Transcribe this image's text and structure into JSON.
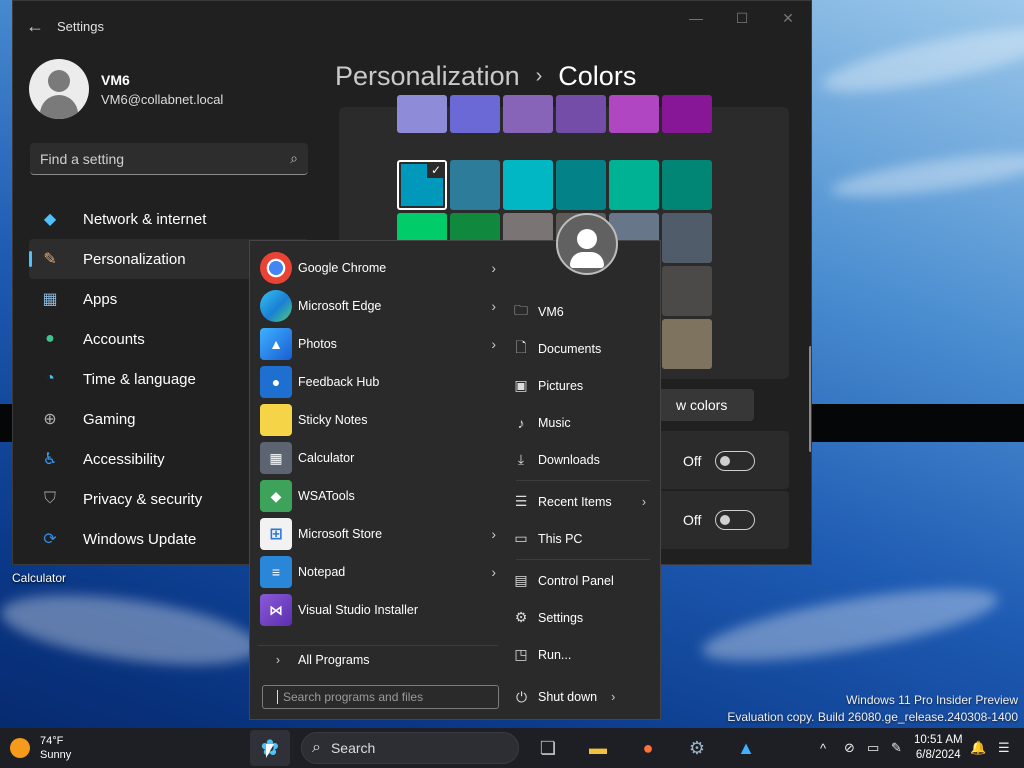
{
  "settings": {
    "window_title": "Settings",
    "user": {
      "name": "VM6",
      "email": "VM6@collabnet.local"
    },
    "search_placeholder": "Find a setting",
    "nav": [
      {
        "label": "Network & internet",
        "icon": "wifi-icon",
        "color": "#4cc2ff"
      },
      {
        "label": "Personalization",
        "icon": "brush-icon",
        "color": "#e8a86a",
        "selected": true
      },
      {
        "label": "Apps",
        "icon": "apps-icon",
        "color": "#8ab4d8"
      },
      {
        "label": "Accounts",
        "icon": "person-icon",
        "color": "#3fc48f"
      },
      {
        "label": "Time & language",
        "icon": "globe-clock-icon",
        "color": "#4cc2ff"
      },
      {
        "label": "Gaming",
        "icon": "gamepad-icon",
        "color": "#b0b0b0"
      },
      {
        "label": "Accessibility",
        "icon": "accessibility-icon",
        "color": "#3aa0ff"
      },
      {
        "label": "Privacy & security",
        "icon": "shield-icon",
        "color": "#9aa3ad"
      },
      {
        "label": "Windows Update",
        "icon": "update-icon",
        "color": "#2f8ee6"
      }
    ],
    "breadcrumb": {
      "parent": "Personalization",
      "separator": "›",
      "current": "Colors"
    },
    "swatches": [
      [
        "#8e8cd8",
        "#6b69d6",
        "#8764b8",
        "#744da9",
        "#b146c2",
        "#881798"
      ],
      [
        "#0099bc",
        "#2d7d9a",
        "#00b7c3",
        "#038387",
        "#00b294",
        "#018574"
      ],
      [
        "#00cc6a",
        "#10893e",
        "#7a7574",
        "#5d5a58",
        "#68768a",
        "#515c6b"
      ],
      [
        "",
        "",
        "",
        "",
        "#567c73",
        "#4c4a48"
      ],
      [
        "",
        "",
        "",
        "",
        "",
        "#7e735f"
      ]
    ],
    "selected_swatch": "#0099bc",
    "view_colors_label": "w colors",
    "toggles": [
      {
        "label": "Off"
      },
      {
        "label": "Off"
      }
    ]
  },
  "start_menu": {
    "programs": [
      {
        "label": "Google Chrome",
        "icon": "chrome-icon",
        "has_submenu": true
      },
      {
        "label": "Microsoft Edge",
        "icon": "edge-icon",
        "has_submenu": true
      },
      {
        "label": "Photos",
        "icon": "photos-icon",
        "has_submenu": true
      },
      {
        "label": "Feedback Hub",
        "icon": "feedback-hub-icon",
        "has_submenu": false
      },
      {
        "label": "Sticky Notes",
        "icon": "sticky-notes-icon",
        "has_submenu": false
      },
      {
        "label": "Calculator",
        "icon": "calculator-icon",
        "has_submenu": false
      },
      {
        "label": "WSATools",
        "icon": "wsatools-icon",
        "has_submenu": false
      },
      {
        "label": "Microsoft Store",
        "icon": "store-icon",
        "has_submenu": true
      },
      {
        "label": "Notepad",
        "icon": "notepad-icon",
        "has_submenu": true
      },
      {
        "label": "Visual Studio Installer",
        "icon": "vs-installer-icon",
        "has_submenu": false
      }
    ],
    "all_programs": "All Programs",
    "search_placeholder": "Search programs and files",
    "places": [
      {
        "label": "VM6",
        "icon": "user-folder-icon"
      },
      {
        "label": "Documents",
        "icon": "document-icon"
      },
      {
        "label": "Pictures",
        "icon": "pictures-icon"
      },
      {
        "label": "Music",
        "icon": "music-icon"
      },
      {
        "label": "Downloads",
        "icon": "download-icon"
      },
      {
        "label": "Recent Items",
        "icon": "recent-icon",
        "has_submenu": true
      },
      {
        "label": "This PC",
        "icon": "computer-icon"
      },
      {
        "label": "Control Panel",
        "icon": "control-panel-icon"
      },
      {
        "label": "Settings",
        "icon": "gear-icon"
      },
      {
        "label": "Run...",
        "icon": "run-icon"
      }
    ],
    "shutdown": "Shut down"
  },
  "desktop": {
    "icon_label": "Calculator",
    "watermark_line1": "Windows 11 Pro Insider Preview",
    "watermark_line2": "Evaluation copy. Build 26080.ge_release.240308-1400"
  },
  "taskbar": {
    "weather_temp": "74°F",
    "weather_desc": "Sunny",
    "search_label": "Search",
    "time": "10:51 AM",
    "date": "6/8/2024"
  }
}
